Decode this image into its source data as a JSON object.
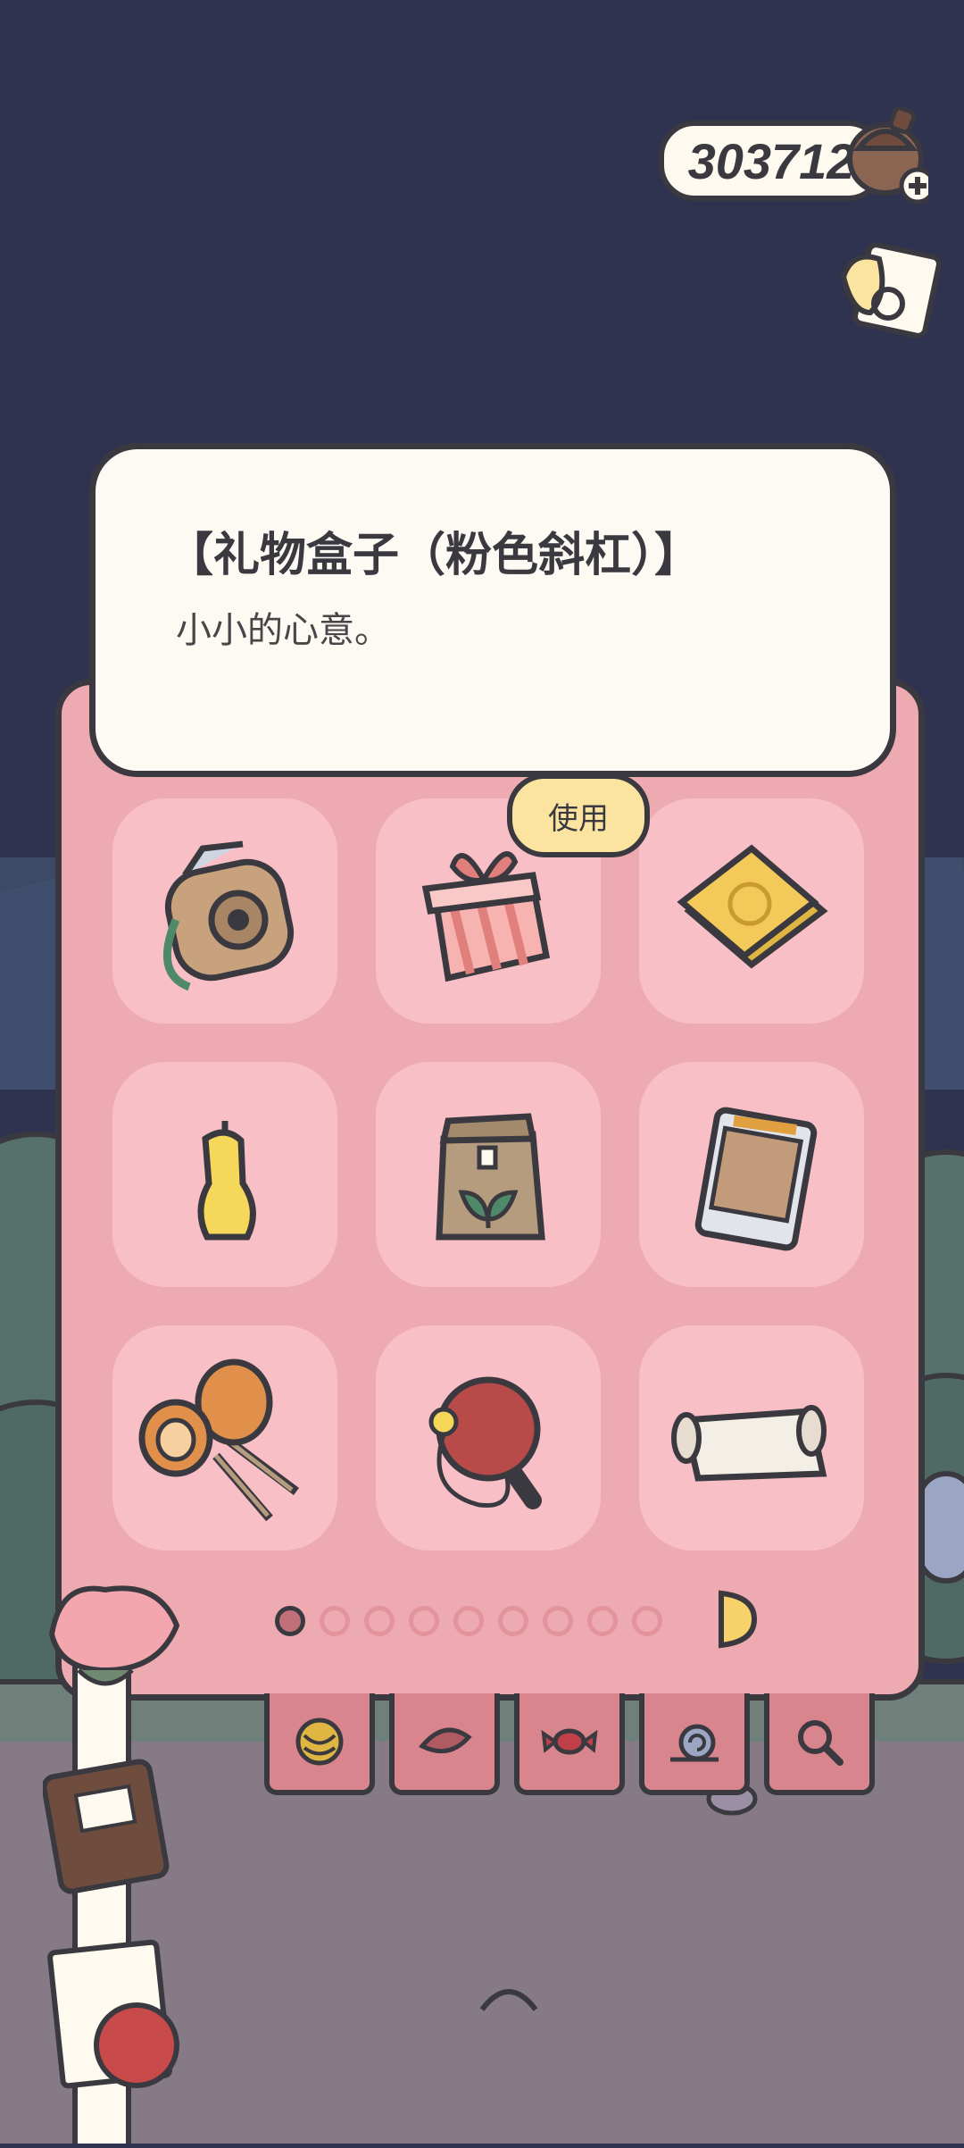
{
  "currency": {
    "amount": "303712",
    "icon": "acorn-icon",
    "add_icon": "plus-icon"
  },
  "tooltip": {
    "title": "【礼物盒子（粉色斜杠）】",
    "description": "小小的心意。"
  },
  "use_button_label": "使用",
  "items": [
    {
      "name": "instant-camera",
      "icon": "camera-icon"
    },
    {
      "name": "gift-box-pink-stripe",
      "icon": "gift-box-icon",
      "selected": true
    },
    {
      "name": "yellow-envelope",
      "icon": "envelope-icon"
    },
    {
      "name": "candle",
      "icon": "candle-icon"
    },
    {
      "name": "paper-bag-sprout",
      "icon": "seed-bag-icon"
    },
    {
      "name": "photo-album",
      "icon": "photo-album-icon"
    },
    {
      "name": "maracas",
      "icon": "maracas-icon"
    },
    {
      "name": "ping-pong-paddle",
      "icon": "paddle-icon"
    },
    {
      "name": "paper-roll",
      "icon": "scroll-icon"
    }
  ],
  "pager": {
    "total_pages": 9,
    "current_page": 1
  },
  "category_tabs": [
    {
      "name": "yarn",
      "icon": "yarn-icon"
    },
    {
      "name": "leaf",
      "icon": "leaf-icon"
    },
    {
      "name": "candy",
      "icon": "candy-icon"
    },
    {
      "name": "snail",
      "icon": "snail-icon"
    },
    {
      "name": "magnifier",
      "icon": "magnifier-icon"
    }
  ],
  "colors": {
    "panel": "#eeaab1",
    "cell": "#f8c0c6",
    "outline": "#3b3940",
    "sky": "#30334f",
    "use_button": "#fbe3a0"
  }
}
